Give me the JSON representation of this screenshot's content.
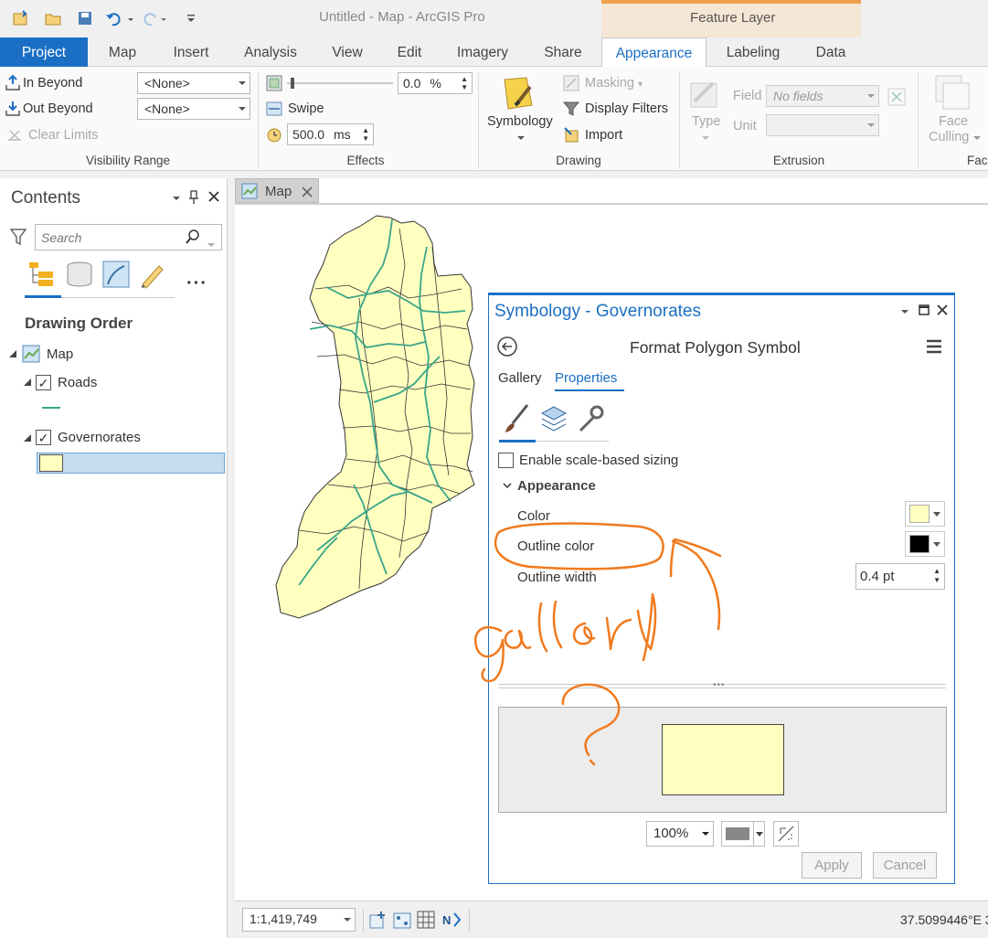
{
  "titlebar": {
    "app_title": "Untitled - Map - ArcGIS Pro",
    "context_tab_group": "Feature Layer"
  },
  "tabs": [
    {
      "label": "Project"
    },
    {
      "label": "Map"
    },
    {
      "label": "Insert"
    },
    {
      "label": "Analysis"
    },
    {
      "label": "View"
    },
    {
      "label": "Edit"
    },
    {
      "label": "Imagery"
    },
    {
      "label": "Share"
    },
    {
      "label": "Appearance"
    },
    {
      "label": "Labeling"
    },
    {
      "label": "Data"
    }
  ],
  "ribbon": {
    "visibility": {
      "in_beyond": "In Beyond",
      "out_beyond": "Out Beyond",
      "clear_limits": "Clear Limits",
      "in_value": "<None>",
      "out_value": "<None>",
      "group_label": "Visibility Range"
    },
    "effects": {
      "transparency_value": "0.0",
      "transparency_unit": "%",
      "swipe": "Swipe",
      "flicker_value": "500.0",
      "flicker_unit": "ms",
      "group_label": "Effects"
    },
    "drawing": {
      "symbology": "Symbology",
      "masking": "Masking",
      "display_filters": "Display Filters",
      "import": "Import",
      "group_label": "Drawing"
    },
    "extrusion": {
      "type": "Type",
      "field_label": "Field",
      "field_value": "No fields",
      "unit_label": "Unit",
      "group_label": "Extrusion"
    },
    "faces": {
      "face_culling_1": "Face",
      "face_culling_2": "Culling",
      "group_label": "Face"
    }
  },
  "contents": {
    "title": "Contents",
    "search_placeholder": "Search",
    "section_title": "Drawing Order",
    "map_item": "Map",
    "layers": [
      {
        "name": "Roads",
        "checked": true
      },
      {
        "name": "Governorates",
        "checked": true
      }
    ]
  },
  "map": {
    "tab_label": "Map",
    "scale": "1:1,419,749",
    "coordinates": "37.5099446°E 3"
  },
  "symbology": {
    "title": "Symbology - Governorates",
    "subtitle": "Format Polygon Symbol",
    "tab_gallery": "Gallery",
    "tab_properties": "Properties",
    "scale_sizing": "Enable scale-based sizing",
    "appearance_header": "Appearance",
    "color_label": "Color",
    "outline_color_label": "Outline color",
    "outline_width_label": "Outline width",
    "outline_width_value": "0.4 pt",
    "fill_color": "#ffffc0",
    "outline_color": "#000000",
    "zoom_value": "100%",
    "apply": "Apply",
    "cancel": "Cancel"
  },
  "annotation": {
    "handwritten_word": "gallery",
    "handwritten_mark": "?",
    "ink_color": "#f07a1e"
  },
  "colors": {
    "accent": "#1a6fc4",
    "polygon_fill": "#ffffc0",
    "road_line": "#3aa58a"
  }
}
